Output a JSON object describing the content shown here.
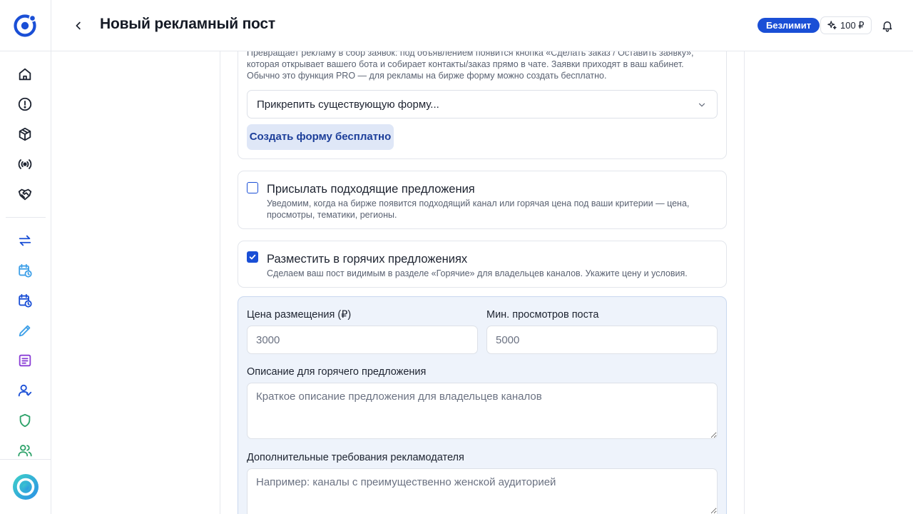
{
  "header": {
    "title": "Новый рекламный пост",
    "plan_badge": "Безлимит",
    "balance": "100 ₽"
  },
  "sidebar": {
    "items": [
      {
        "icon": "home-icon",
        "color": "#1d2330"
      },
      {
        "icon": "alert-circle-icon",
        "color": "#1d2330"
      },
      {
        "icon": "package-icon",
        "color": "#1d2330"
      },
      {
        "icon": "broadcast-icon",
        "color": "#1d2330"
      },
      {
        "icon": "handshake-icon",
        "color": "#1d2330"
      },
      {
        "icon": "exchange-icon",
        "color": "#1a4fd6"
      },
      {
        "icon": "calendar-clock-icon",
        "color": "#3fa0e8"
      },
      {
        "icon": "calendar-clock-icon",
        "color": "#1a4fd6"
      },
      {
        "icon": "pencil-icon",
        "color": "#3fa0e8"
      },
      {
        "icon": "document-icon",
        "color": "#8a3fd6"
      },
      {
        "icon": "user-check-icon",
        "color": "#1a4fd6"
      },
      {
        "icon": "shield-icon",
        "color": "#2fa36b"
      },
      {
        "icon": "users-icon",
        "color": "#2fa36b"
      }
    ]
  },
  "lead_form": {
    "description": "Превращает рекламу в сбор заявок: под объявлением появится кнопка «Сделать заказ / Оставить заявку», которая открывает вашего бота и собирает контакты/заказ прямо в чате. Заявки приходят в ваш кабинет. Обычно это функция PRO — для рекламы на бирже форму можно создать бесплатно.",
    "select_value": "Прикрепить существующую форму...",
    "create_button": "Создать форму бесплатно"
  },
  "offers_option": {
    "checked": false,
    "title": "Присылать подходящие предложения",
    "description": "Уведомим, когда на бирже появится подходящий канал или горячая цена под ваши критерии — цена, просмотры, тематики, регионы."
  },
  "hot_option": {
    "checked": true,
    "title": "Разместить в горячих предложениях",
    "description": "Сделаем ваш пост видимым в разделе «Горячие» для владельцев каналов. Укажите цену и условия."
  },
  "hot_form": {
    "price_label": "Цена размещения (₽)",
    "price_placeholder": "3000",
    "views_label": "Мин. просмотров поста",
    "views_placeholder": "5000",
    "description_label": "Описание для горячего предложения",
    "description_placeholder": "Краткое описание предложения для владельцев каналов",
    "requirements_label": "Дополнительные требования рекламодателя",
    "requirements_placeholder": "Например: каналы с преимущественно женской аудиторией"
  },
  "colors": {
    "accent": "#1a4fd6",
    "panel_bg": "#eef3fb",
    "button_soft_bg": "#dfe7f7"
  }
}
